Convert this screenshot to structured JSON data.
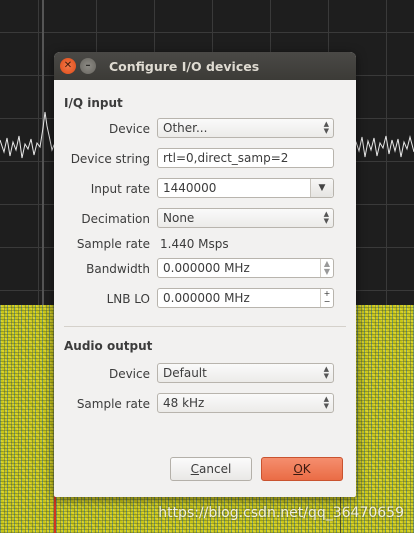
{
  "dialog": {
    "title": "Configure I/O devices",
    "iq_input": {
      "section_label": "I/Q input",
      "device_label": "Device",
      "device_value": "Other...",
      "device_string_label": "Device string",
      "device_string_value": "rtl=0,direct_samp=2",
      "input_rate_label": "Input rate",
      "input_rate_value": "1440000",
      "decimation_label": "Decimation",
      "decimation_value": "None",
      "sample_rate_label": "Sample rate",
      "sample_rate_value": "1.440 Msps",
      "bandwidth_label": "Bandwidth",
      "bandwidth_value": "0.000000 MHz",
      "lnb_lo_label": "LNB LO",
      "lnb_lo_value": "0.000000 MHz"
    },
    "audio_output": {
      "section_label": "Audio output",
      "device_label": "Device",
      "device_value": "Default",
      "sample_rate_label": "Sample rate",
      "sample_rate_value": "48 kHz"
    },
    "buttons": {
      "cancel_first": "C",
      "cancel_rest": "ancel",
      "ok_first": "O",
      "ok_rest": "K"
    }
  },
  "watermark": "https://blog.csdn.net/qq_36470659",
  "colors": {
    "title_bar": "#3c3b37",
    "dialog_bg": "#f2f1f0",
    "ok_button": "#ea6c45",
    "close_button": "#df4b16",
    "waterfall": "#c9c61a",
    "spectrum_bg": "#1e1e1e"
  },
  "icons": {
    "close": "close-icon",
    "minimize": "minimize-icon",
    "combo_arrow": "chevron-down-icon",
    "spin_arrows": "spin-arrows-icon"
  }
}
